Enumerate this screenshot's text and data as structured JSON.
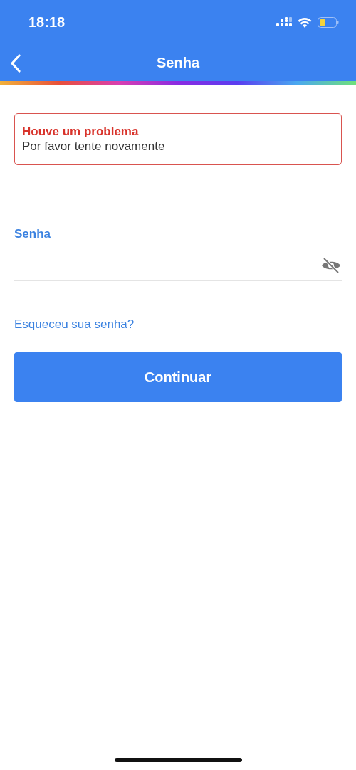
{
  "status_bar": {
    "time": "18:18"
  },
  "nav": {
    "title": "Senha"
  },
  "error": {
    "title": "Houve um problema",
    "message": "Por favor tente novamente"
  },
  "password_field": {
    "label": "Senha",
    "masked": true
  },
  "forgot_link": "Esqueceu sua senha?",
  "submit_button": "Continuar"
}
